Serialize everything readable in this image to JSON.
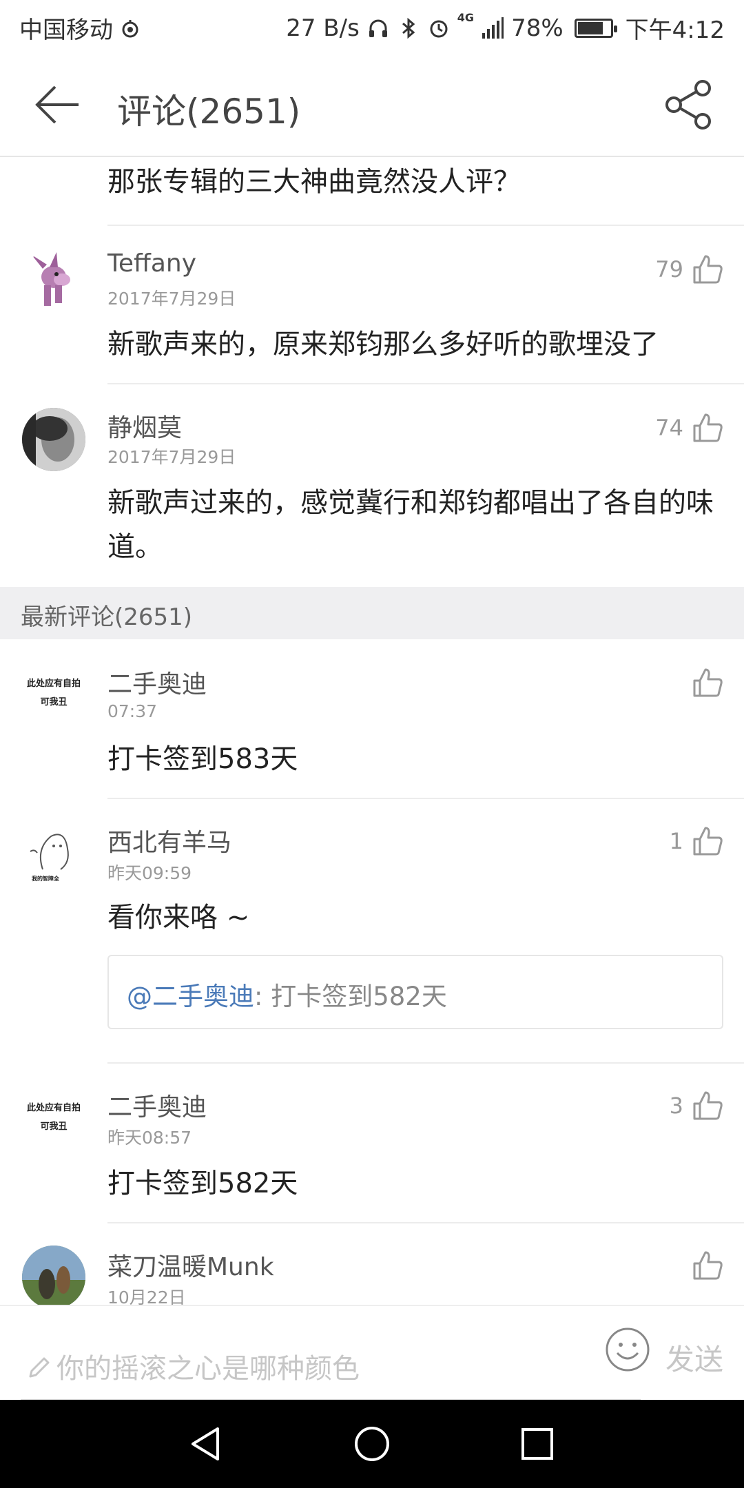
{
  "status_bar": {
    "carrier": "中国移动",
    "speed": "27 B/s",
    "network": "4G",
    "battery_pct_label": "78%",
    "battery_level": 0.78,
    "time": "下午4:12"
  },
  "app_bar": {
    "title": "评论(2651)"
  },
  "hot_comments": [
    {
      "text": "那张专辑的三大神曲竟然没人评？"
    },
    {
      "username": "Teffany",
      "date": "2017年7月29日",
      "likes": "79",
      "text": "新歌声来的，原来郑钧那么多好听的歌埋没了"
    },
    {
      "username": "静烟莫",
      "date": "2017年7月29日",
      "likes": "74",
      "text": "新歌声过来的，感觉冀行和郑钧都唱出了各自的味道。"
    }
  ],
  "latest_section": {
    "title": "最新评论(2651)"
  },
  "latest_comments": [
    {
      "username": "二手奥迪",
      "date": "07:37",
      "likes": "",
      "text": "打卡签到583天",
      "avatar_text": [
        "此处应有自拍",
        "可我丑"
      ]
    },
    {
      "username": "西北有羊马",
      "date": "昨天09:59",
      "likes": "1",
      "text": "看你来咯 ~",
      "avatar_caption": "我的智障全",
      "reply": {
        "at_user": "@二手奥迪",
        "text": ": 打卡签到582天"
      }
    },
    {
      "username": "二手奥迪",
      "date": "昨天08:57",
      "likes": "3",
      "text": "打卡签到582天",
      "avatar_text": [
        "此处应有自拍",
        "可我丑"
      ]
    },
    {
      "username": "菜刀温暖Munk",
      "date": "10月22日",
      "likes": ""
    }
  ],
  "input_bar": {
    "placeholder": "你的摇滚之心是哪种颜色",
    "send_label": "发送"
  },
  "nav_bar": {
    "back": "back-nav-icon",
    "home": "home-nav-icon",
    "recents": "recents-nav-icon"
  }
}
